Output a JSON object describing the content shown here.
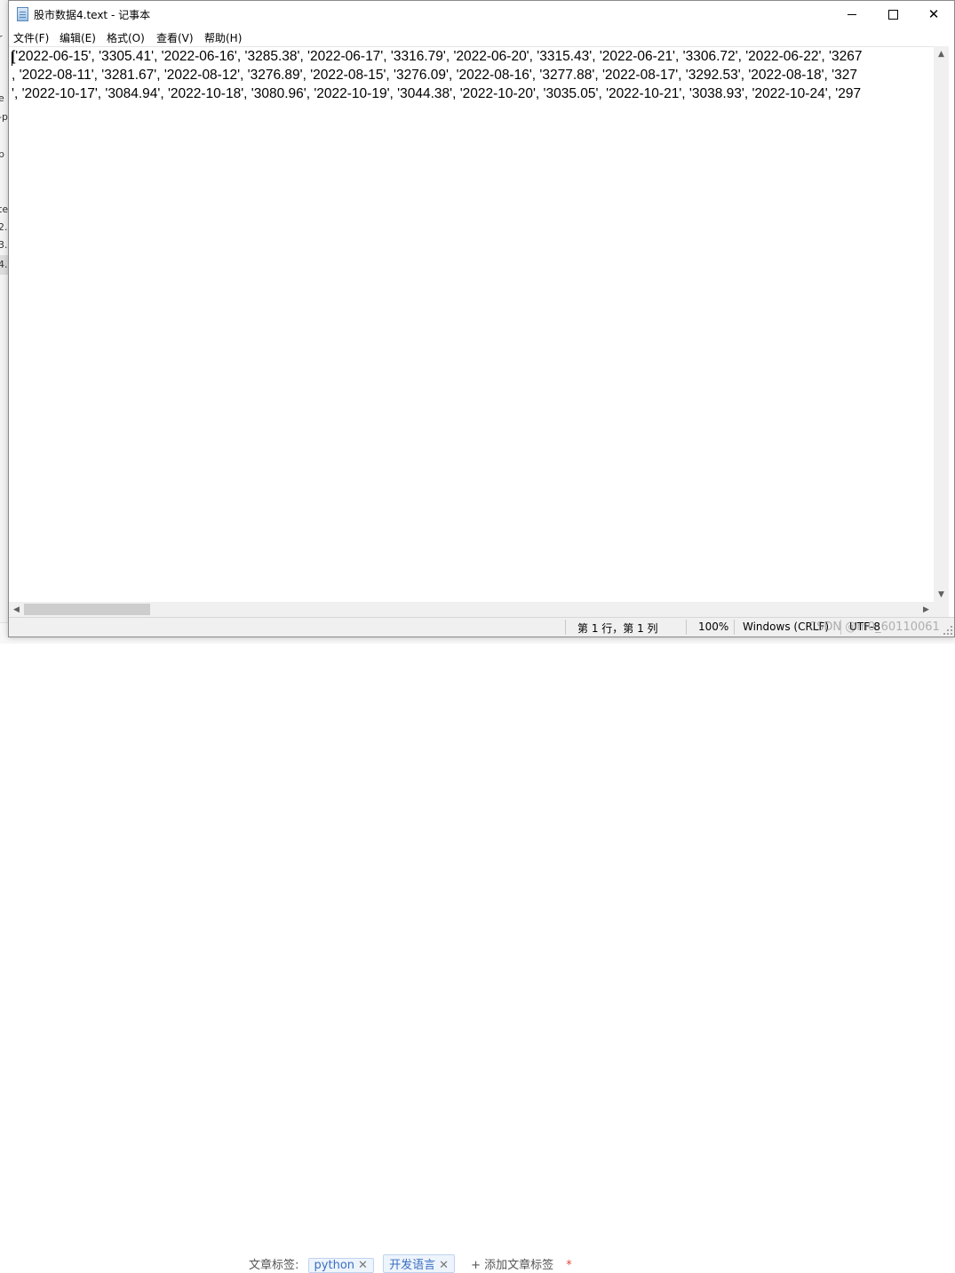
{
  "window": {
    "title": "股市数据4.text - 记事本",
    "icon": "notepad-icon"
  },
  "menu": {
    "file": "文件(F)",
    "edit": "编辑(E)",
    "format": "格式(O)",
    "view": "查看(V)",
    "help": "帮助(H)"
  },
  "editor": {
    "lines": [
      "['2022-06-15', '3305.41', '2022-06-16', '3285.38', '2022-06-17', '3316.79', '2022-06-20', '3315.43', '2022-06-21', '3306.72', '2022-06-22', '3267",
      ", '2022-08-11', '3281.67', '2022-08-12', '3276.89', '2022-08-15', '3276.09', '2022-08-16', '3277.88', '2022-08-17', '3292.53', '2022-08-18', '327",
      "', '2022-10-17', '3084.94', '2022-10-18', '3080.96', '2022-10-19', '3044.38', '2022-10-20', '3035.05', '2022-10-21', '3038.93', '2022-10-24', '297"
    ]
  },
  "status": {
    "position": "第 1 行，第 1 列",
    "zoom": "100%",
    "line_ending": "Windows (CRLF)",
    "encoding": "UTF-8",
    "watermark": "CSDN @m0_60110061"
  },
  "background_page": {
    "fragments": [
      "r",
      "e",
      "-p",
      "p",
      "te",
      "2.",
      "3.",
      "4."
    ],
    "tags_label": "文章标签:",
    "tags": [
      "python",
      "开发语言"
    ],
    "add_tag": "+ 添加文章标签",
    "required_mark": "*"
  },
  "colors": {
    "window_bg": "#ffffff",
    "chrome_bg": "#f0f0f0",
    "scroll_thumb": "#cdcdcd"
  }
}
